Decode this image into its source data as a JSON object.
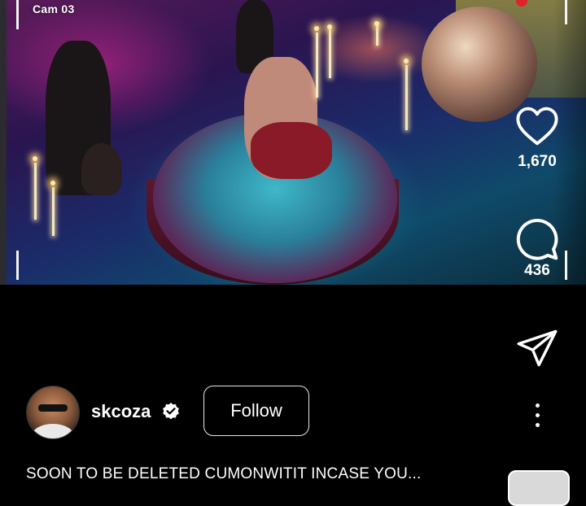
{
  "video": {
    "camera_label": "Cam 03",
    "accent_color": "#e0222a"
  },
  "actions": {
    "like": {
      "icon": "heart-icon",
      "count": "1,670"
    },
    "comment": {
      "icon": "comment-bubble-icon",
      "count": "436"
    },
    "share": {
      "icon": "send-icon"
    }
  },
  "owner": {
    "username": "skcoza",
    "verified": true,
    "follow_label": "Follow",
    "more_icon": "more-vertical-icon"
  },
  "caption": {
    "text": "SOON TO BE DELETED CUMONWITIT INCASE YOU..."
  }
}
